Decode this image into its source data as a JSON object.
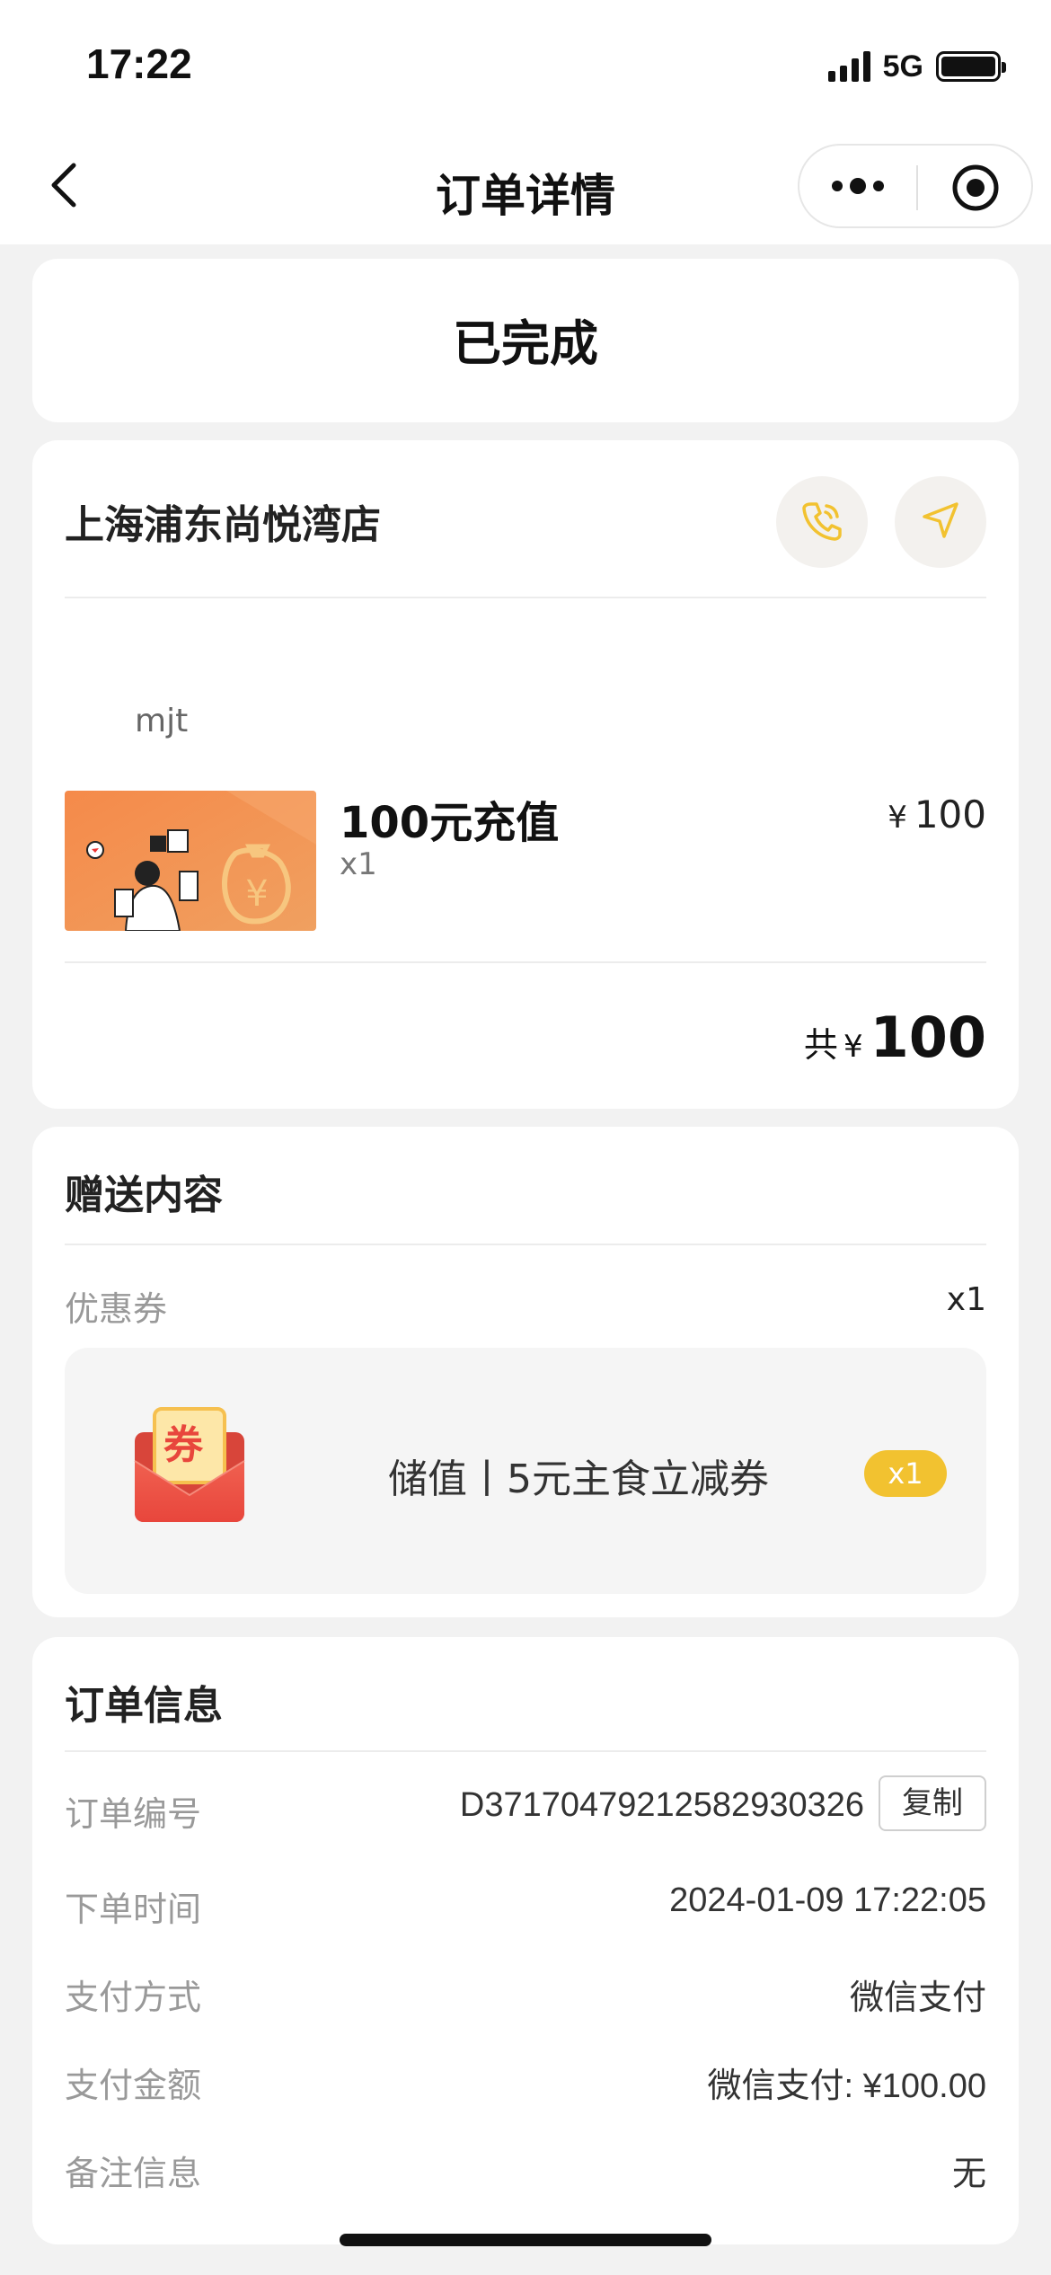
{
  "status_bar": {
    "time": "17:22",
    "network": "5G"
  },
  "nav": {
    "title": "订单详情",
    "icons": [
      "back-arrow-icon",
      "more-dots-icon",
      "target-icon"
    ]
  },
  "order_status": "已完成",
  "store": {
    "name": "上海浦东尚悦湾店",
    "icons": [
      "phone-icon",
      "navigate-icon"
    ],
    "user": "mjt",
    "product": {
      "name": "100元充值",
      "qty": "x1",
      "currency": "¥",
      "price": "100"
    },
    "total": {
      "label": "共",
      "currency": "¥",
      "amount": "100"
    }
  },
  "gift": {
    "title": "赠送内容",
    "coupon_label": "优惠券",
    "coupon_count": "x1",
    "coupon": {
      "icon_text": "券",
      "name": "储值丨5元主食立减券",
      "badge": "x1"
    }
  },
  "order_info": {
    "title": "订单信息",
    "rows": [
      {
        "label": "订单编号",
        "value": "D37170479212582930326"
      },
      {
        "label": "下单时间",
        "value": "2024-01-09 17:22:05"
      },
      {
        "label": "支付方式",
        "value": "微信支付"
      },
      {
        "label": "支付金额",
        "value": "微信支付: ¥100.00"
      },
      {
        "label": "备注信息",
        "value": "无"
      }
    ],
    "copy_label": "复制"
  },
  "colors": {
    "accent": "#f2c230",
    "page_bg": "#f2f2f2",
    "card_bg": "#ffffff"
  }
}
